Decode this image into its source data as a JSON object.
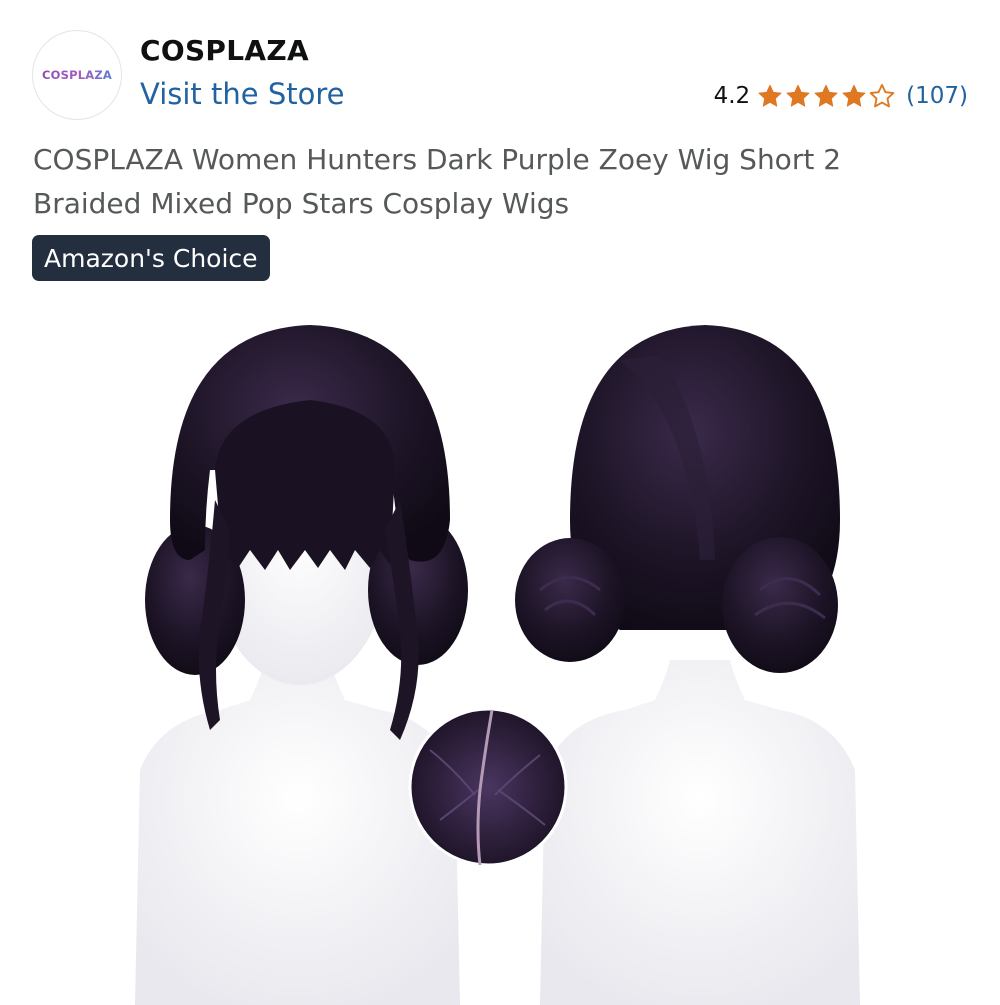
{
  "store": {
    "logo_text": "COSPLAZA",
    "name": "COSPLAZA",
    "visit_label": "Visit the Store"
  },
  "rating": {
    "value": "4.2",
    "stars": 4.2,
    "review_count": "(107)",
    "star_color": "#de7921"
  },
  "product": {
    "title": "COSPLAZA Women Hunters Dark Purple Zoey Wig Short 2 Braided Mixed Pop Stars Cosplay Wigs",
    "badge": "Amazon's Choice"
  },
  "colors": {
    "link": "#2162a1",
    "badge_bg": "#232f3e",
    "wig": "#1d1426"
  }
}
